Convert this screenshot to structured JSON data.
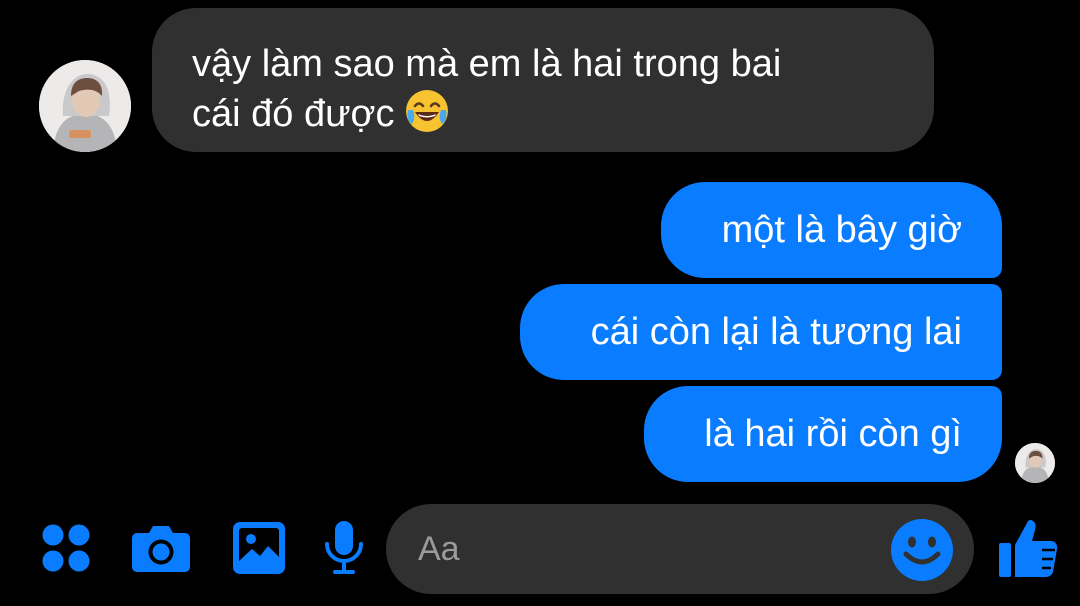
{
  "conversation": {
    "incoming": {
      "lines": [
        "vậy làm sao mà em là hai trong bai",
        "cái đó được"
      ],
      "emoji": "face-with-tears-of-joy"
    },
    "outgoing": [
      {
        "text": "một là bây giờ"
      },
      {
        "text": "cái còn lại là tương lai"
      },
      {
        "text": "là hai rồi còn gì"
      }
    ]
  },
  "composer": {
    "placeholder": "Aa",
    "icons": [
      "more-apps-icon",
      "camera-icon",
      "gallery-icon",
      "microphone-icon",
      "emoji-icon",
      "thumbs-up-icon"
    ]
  },
  "colors": {
    "background": "#000000",
    "incoming_bubble": "#303030",
    "outgoing_bubble": "#0a7cff",
    "accent": "#0a7cff",
    "input_background": "#303030"
  }
}
